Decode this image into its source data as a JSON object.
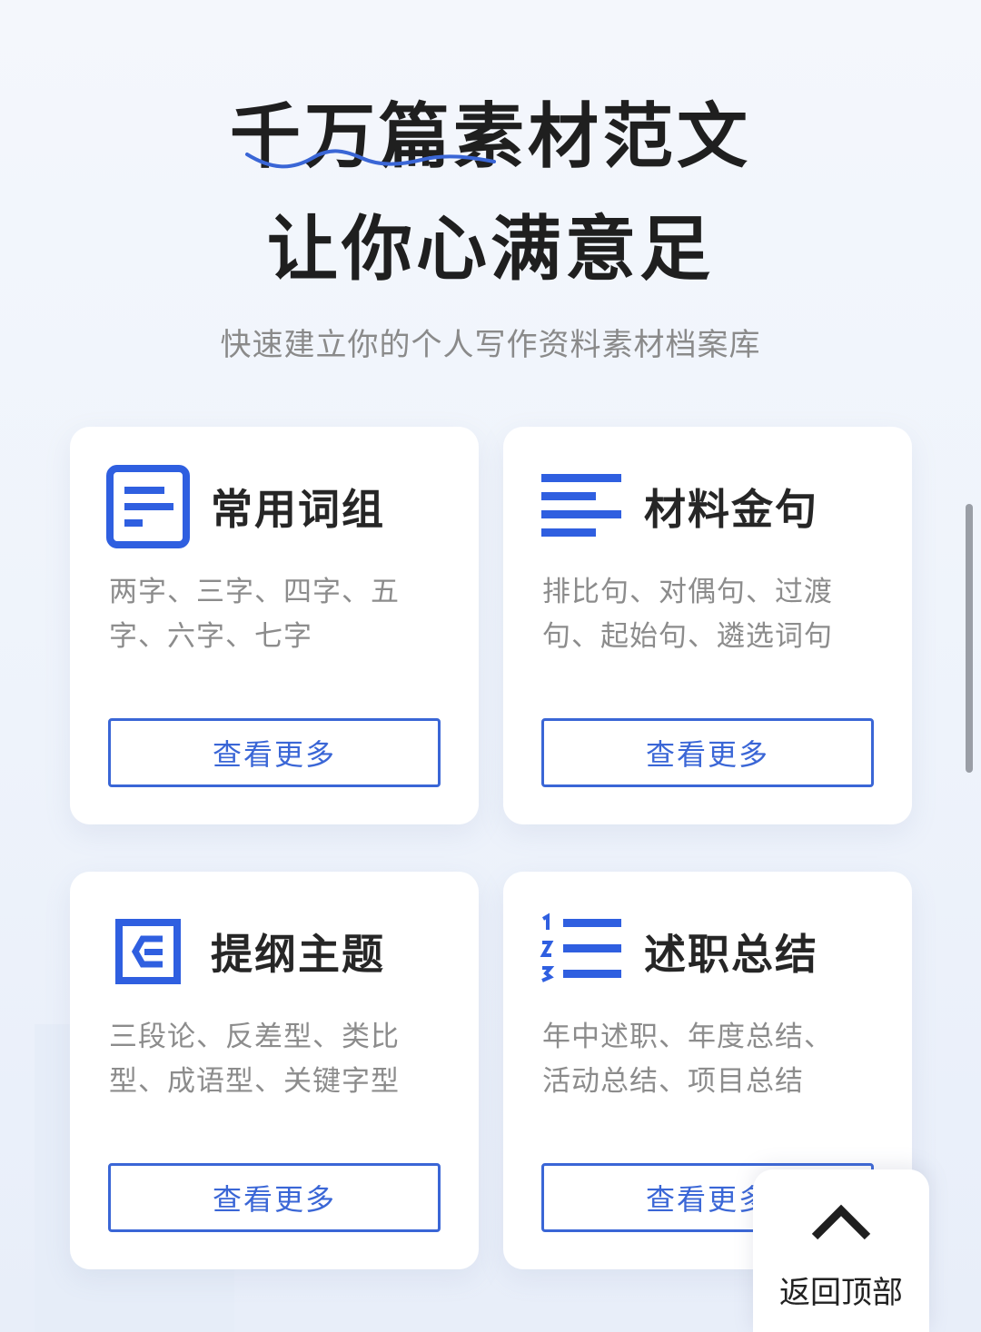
{
  "hero": {
    "headline_line1": "千万篇素材范文",
    "headline_line2": "让你心满意足",
    "subtitle": "快速建立你的个人写作资料素材档案库"
  },
  "cards": [
    {
      "title": "常用词组",
      "description": "两字、三字、四字、五字、六字、七字",
      "button_label": "查看更多",
      "icon": "document-lines-icon"
    },
    {
      "title": "材料金句",
      "description": "排比句、对偶句、过渡句、起始句、遴选词句",
      "button_label": "查看更多",
      "icon": "text-lines-icon"
    },
    {
      "title": "提纲主题",
      "description": "三段论、反差型、类比型、成语型、关键字型",
      "button_label": "查看更多",
      "icon": "outline-e-icon"
    },
    {
      "title": "述职总结",
      "description": "年中述职、年度总结、活动总结、项目总结",
      "button_label": "查看更多",
      "icon": "numbered-list-icon"
    }
  ],
  "back_to_top": {
    "label": "返回顶部",
    "icon": "chevron-up-icon"
  },
  "colors": {
    "accent": "#3a66d6",
    "icon_blue": "#2f5fe0",
    "squiggle": "#3a66d6"
  }
}
